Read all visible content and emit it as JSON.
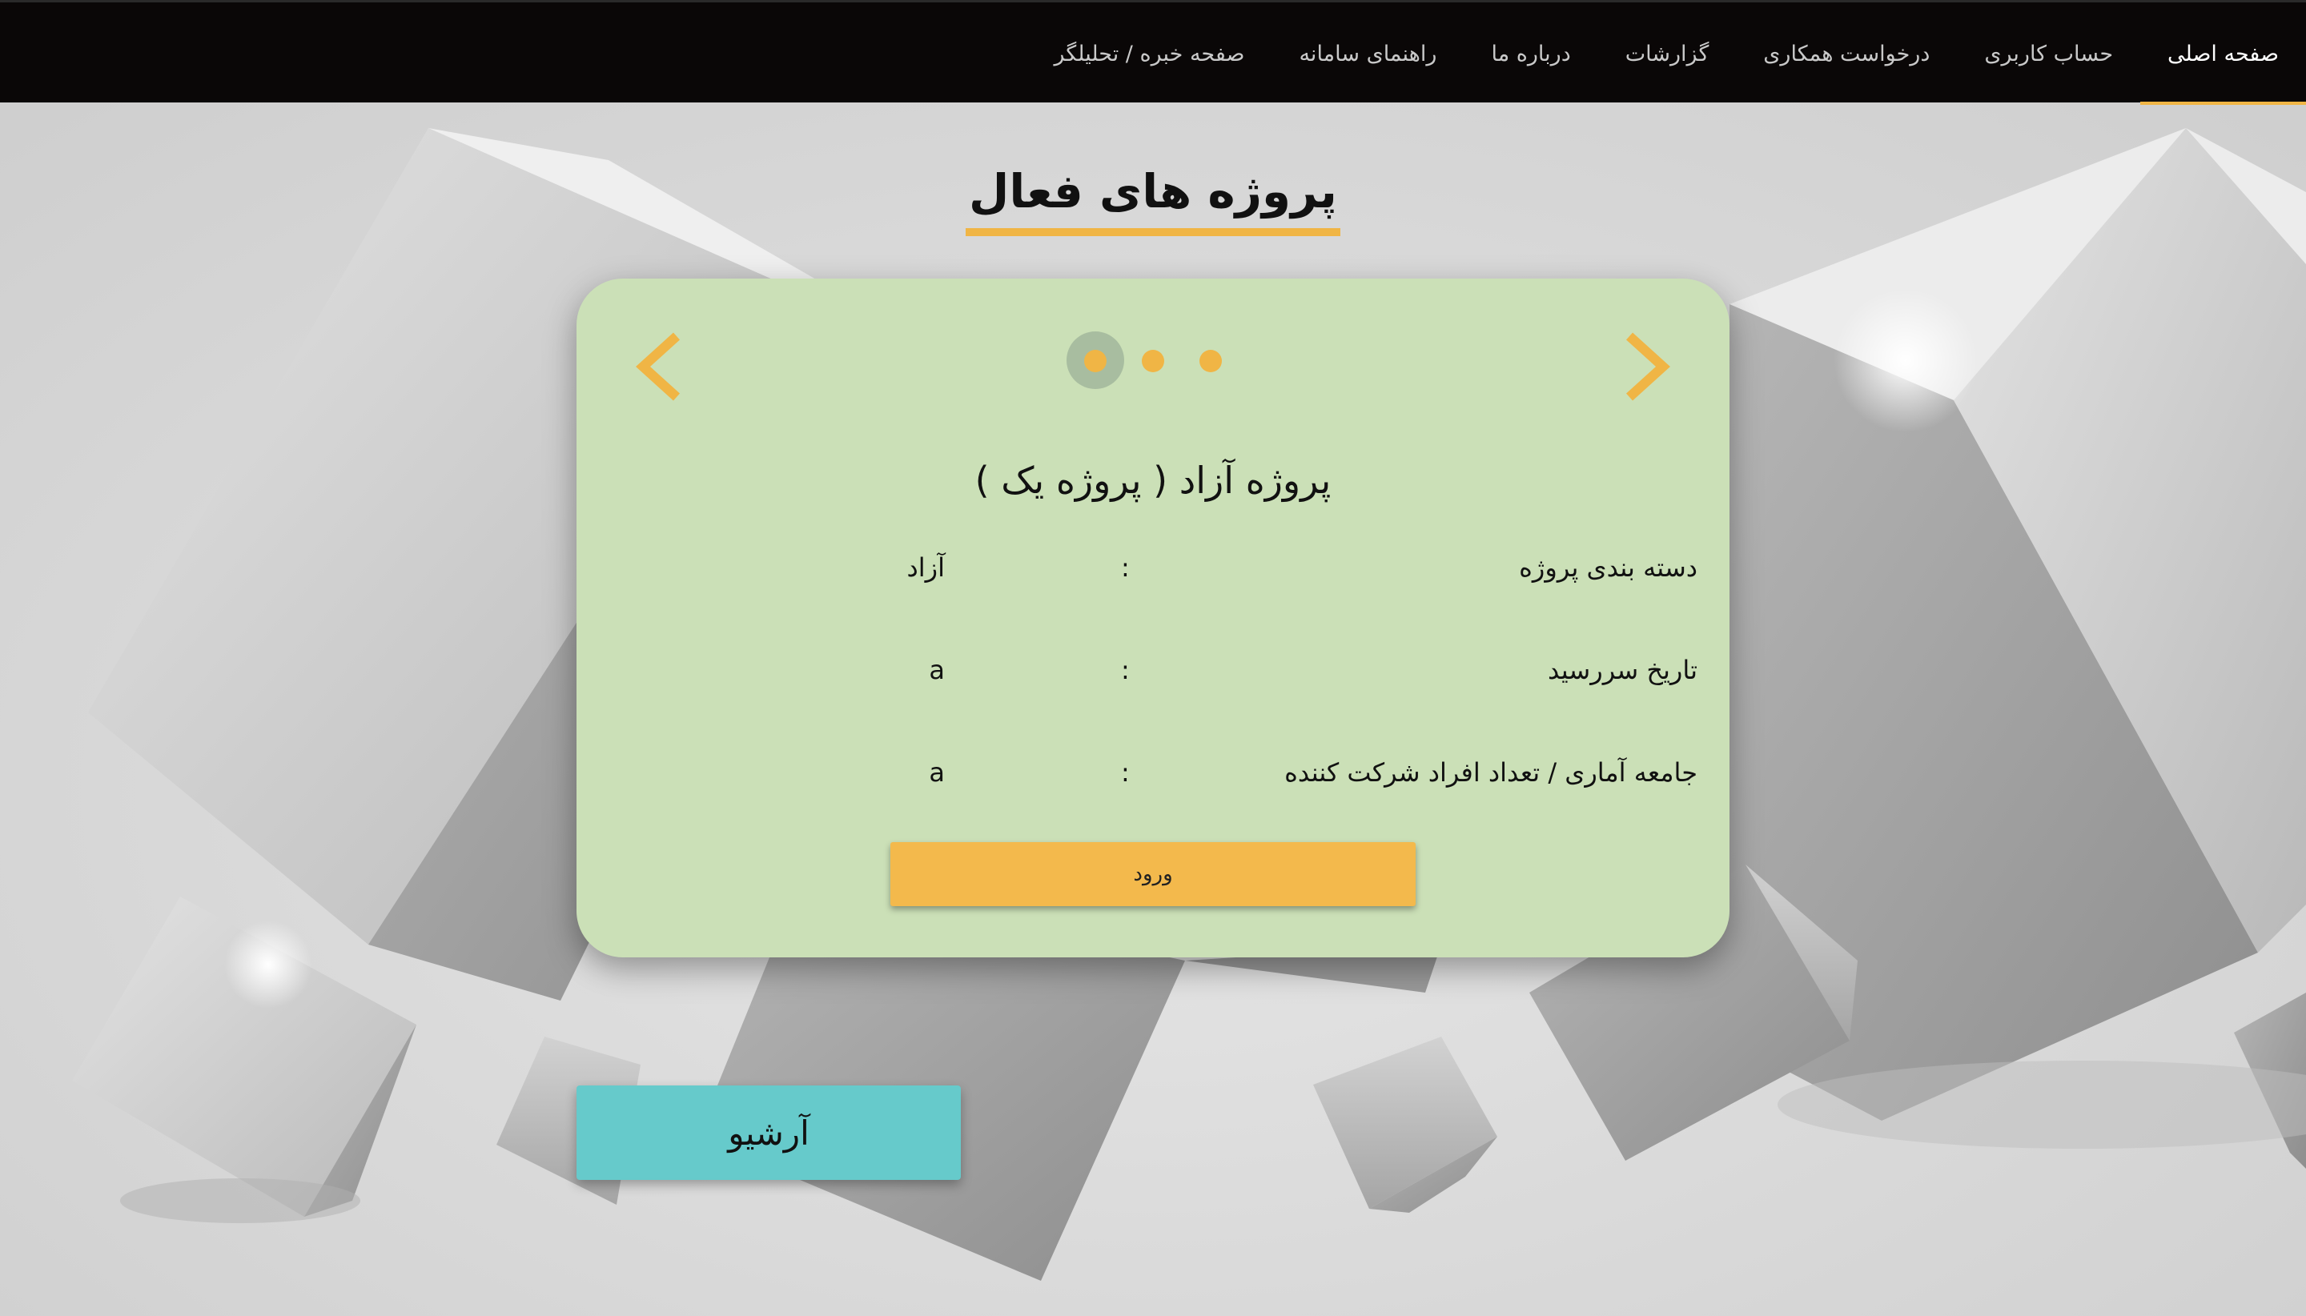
{
  "nav": {
    "items": [
      {
        "label": "صفحه اصلی",
        "active": true
      },
      {
        "label": "حساب کاربری",
        "active": false
      },
      {
        "label": "درخواست همکاری",
        "active": false
      },
      {
        "label": "گزارشات",
        "active": false
      },
      {
        "label": "درباره ما",
        "active": false
      },
      {
        "label": "راهنمای سامانه",
        "active": false
      },
      {
        "label": "صفحه خبره / تحلیلگر",
        "active": false
      }
    ]
  },
  "page": {
    "title": "پروژه های فعال"
  },
  "carousel": {
    "prev_icon": "chevron-left-icon",
    "next_icon": "chevron-right-icon",
    "slide_count": 3,
    "active_slide": 1,
    "project": {
      "title": "پروژه آزاد ( پروژه یک )",
      "fields": [
        {
          "label": "دسته بندی پروژه",
          "separator": ":",
          "value": "آزاد"
        },
        {
          "label": "تاریخ سررسید",
          "separator": ":",
          "value": "a"
        },
        {
          "label": "جامعه آماری / تعداد افراد شرکت کننده",
          "separator": ":",
          "value": "a"
        }
      ],
      "enter_label": "ورود"
    }
  },
  "archive_label": "آرشیو",
  "colors": {
    "nav_bg": "#0a0707",
    "accent": "#f0b545",
    "card_bg": "#cbe0b7",
    "archive_bg": "#66cacb"
  }
}
